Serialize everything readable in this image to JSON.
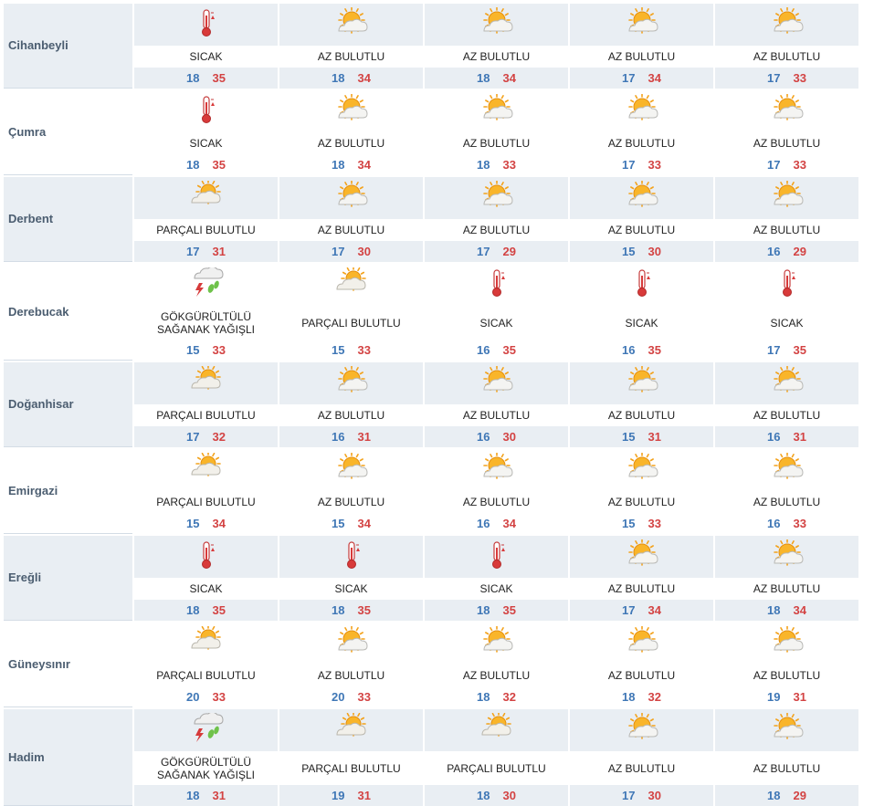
{
  "forecast": [
    {
      "city": "Cihanbeyli",
      "days": [
        {
          "cond": "SICAK",
          "icon": "thermometer-hot-icon",
          "low": "18",
          "high": "35"
        },
        {
          "cond": "AZ BULUTLU",
          "icon": "sun-cloud-icon",
          "low": "18",
          "high": "34"
        },
        {
          "cond": "AZ BULUTLU",
          "icon": "sun-cloud-icon",
          "low": "18",
          "high": "34"
        },
        {
          "cond": "AZ BULUTLU",
          "icon": "sun-cloud-icon",
          "low": "17",
          "high": "34"
        },
        {
          "cond": "AZ BULUTLU",
          "icon": "sun-cloud-icon",
          "low": "17",
          "high": "33"
        }
      ]
    },
    {
      "city": "Çumra",
      "days": [
        {
          "cond": "SICAK",
          "icon": "thermometer-hot-icon",
          "low": "18",
          "high": "35"
        },
        {
          "cond": "AZ BULUTLU",
          "icon": "sun-cloud-icon",
          "low": "18",
          "high": "34"
        },
        {
          "cond": "AZ BULUTLU",
          "icon": "sun-cloud-icon",
          "low": "18",
          "high": "33"
        },
        {
          "cond": "AZ BULUTLU",
          "icon": "sun-cloud-icon",
          "low": "17",
          "high": "33"
        },
        {
          "cond": "AZ BULUTLU",
          "icon": "sun-cloud-icon",
          "low": "17",
          "high": "33"
        }
      ]
    },
    {
      "city": "Derbent",
      "days": [
        {
          "cond": "PARÇALI BULUTLU",
          "icon": "partly-cloudy-icon",
          "low": "17",
          "high": "31"
        },
        {
          "cond": "AZ BULUTLU",
          "icon": "sun-cloud-icon",
          "low": "17",
          "high": "30"
        },
        {
          "cond": "AZ BULUTLU",
          "icon": "sun-cloud-icon",
          "low": "17",
          "high": "29"
        },
        {
          "cond": "AZ BULUTLU",
          "icon": "sun-cloud-icon",
          "low": "15",
          "high": "30"
        },
        {
          "cond": "AZ BULUTLU",
          "icon": "sun-cloud-icon",
          "low": "16",
          "high": "29"
        }
      ]
    },
    {
      "city": "Derebucak",
      "days": [
        {
          "cond": "GÖKGÜRÜLTÜLÜ SAĞANAK YAĞIŞLI",
          "icon": "thunderstorm-rain-icon",
          "low": "15",
          "high": "33"
        },
        {
          "cond": "PARÇALI BULUTLU",
          "icon": "partly-cloudy-icon",
          "low": "15",
          "high": "33"
        },
        {
          "cond": "SICAK",
          "icon": "thermometer-hot-icon",
          "low": "16",
          "high": "35"
        },
        {
          "cond": "SICAK",
          "icon": "thermometer-hot-icon",
          "low": "16",
          "high": "35"
        },
        {
          "cond": "SICAK",
          "icon": "thermometer-hot-icon",
          "low": "17",
          "high": "35"
        }
      ]
    },
    {
      "city": "Doğanhisar",
      "days": [
        {
          "cond": "PARÇALI BULUTLU",
          "icon": "partly-cloudy-icon",
          "low": "17",
          "high": "32"
        },
        {
          "cond": "AZ BULUTLU",
          "icon": "sun-cloud-icon",
          "low": "16",
          "high": "31"
        },
        {
          "cond": "AZ BULUTLU",
          "icon": "sun-cloud-icon",
          "low": "16",
          "high": "30"
        },
        {
          "cond": "AZ BULUTLU",
          "icon": "sun-cloud-icon",
          "low": "15",
          "high": "31"
        },
        {
          "cond": "AZ BULUTLU",
          "icon": "sun-cloud-icon",
          "low": "16",
          "high": "31"
        }
      ]
    },
    {
      "city": "Emirgazi",
      "days": [
        {
          "cond": "PARÇALI BULUTLU",
          "icon": "partly-cloudy-icon",
          "low": "15",
          "high": "34"
        },
        {
          "cond": "AZ BULUTLU",
          "icon": "sun-cloud-icon",
          "low": "15",
          "high": "34"
        },
        {
          "cond": "AZ BULUTLU",
          "icon": "sun-cloud-icon",
          "low": "16",
          "high": "34"
        },
        {
          "cond": "AZ BULUTLU",
          "icon": "sun-cloud-icon",
          "low": "15",
          "high": "33"
        },
        {
          "cond": "AZ BULUTLU",
          "icon": "sun-cloud-icon",
          "low": "16",
          "high": "33"
        }
      ]
    },
    {
      "city": "Ereğli",
      "days": [
        {
          "cond": "SICAK",
          "icon": "thermometer-hot-icon",
          "low": "18",
          "high": "35"
        },
        {
          "cond": "SICAK",
          "icon": "thermometer-hot-icon",
          "low": "18",
          "high": "35"
        },
        {
          "cond": "SICAK",
          "icon": "thermometer-hot-icon",
          "low": "18",
          "high": "35"
        },
        {
          "cond": "AZ BULUTLU",
          "icon": "sun-cloud-icon",
          "low": "17",
          "high": "34"
        },
        {
          "cond": "AZ BULUTLU",
          "icon": "sun-cloud-icon",
          "low": "18",
          "high": "34"
        }
      ]
    },
    {
      "city": "Güneysınır",
      "days": [
        {
          "cond": "PARÇALI BULUTLU",
          "icon": "partly-cloudy-icon",
          "low": "20",
          "high": "33"
        },
        {
          "cond": "AZ BULUTLU",
          "icon": "sun-cloud-icon",
          "low": "20",
          "high": "33"
        },
        {
          "cond": "AZ BULUTLU",
          "icon": "sun-cloud-icon",
          "low": "18",
          "high": "32"
        },
        {
          "cond": "AZ BULUTLU",
          "icon": "sun-cloud-icon",
          "low": "18",
          "high": "32"
        },
        {
          "cond": "AZ BULUTLU",
          "icon": "sun-cloud-icon",
          "low": "19",
          "high": "31"
        }
      ]
    },
    {
      "city": "Hadim",
      "days": [
        {
          "cond": "GÖKGÜRÜLTÜLÜ SAĞANAK YAĞIŞLI",
          "icon": "thunderstorm-rain-icon",
          "low": "18",
          "high": "31"
        },
        {
          "cond": "PARÇALI BULUTLU",
          "icon": "partly-cloudy-icon",
          "low": "19",
          "high": "31"
        },
        {
          "cond": "PARÇALI BULUTLU",
          "icon": "partly-cloudy-icon",
          "low": "18",
          "high": "30"
        },
        {
          "cond": "AZ BULUTLU",
          "icon": "sun-cloud-icon",
          "low": "17",
          "high": "30"
        },
        {
          "cond": "AZ BULUTLU",
          "icon": "sun-cloud-icon",
          "low": "18",
          "high": "29"
        }
      ]
    }
  ],
  "colors": {
    "low": "#3f77b6",
    "high": "#d34343",
    "band": "#e9eef3",
    "city_text": "#4b5d70"
  }
}
